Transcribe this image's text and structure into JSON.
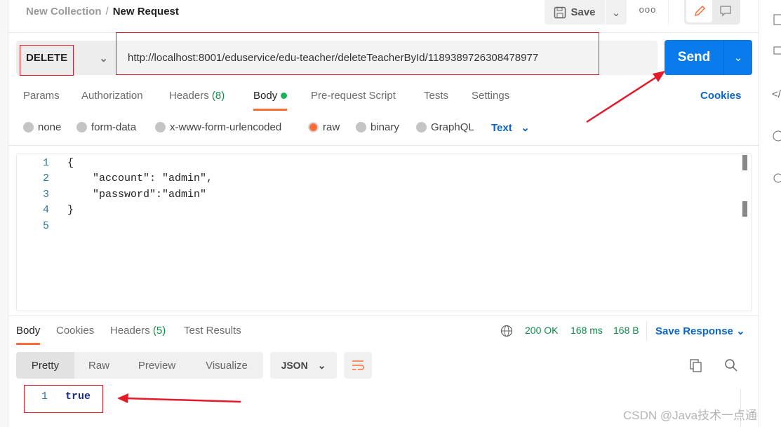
{
  "header": {
    "collection": "New Collection",
    "separator": "/",
    "request": "New Request",
    "save_label": "Save",
    "more_label": "ooo"
  },
  "request": {
    "method": "DELETE",
    "url": "http://localhost:8001/eduservice/edu-teacher/deleteTeacherById/1189389726308478977",
    "send_label": "Send"
  },
  "tabs": [
    {
      "label": "Params"
    },
    {
      "label": "Authorization"
    },
    {
      "label": "Headers",
      "count": "(8)"
    },
    {
      "label": "Body"
    },
    {
      "label": "Pre-request Script"
    },
    {
      "label": "Tests"
    },
    {
      "label": "Settings"
    }
  ],
  "cookies_label": "Cookies",
  "body_types": [
    "none",
    "form-data",
    "x-www-form-urlencoded",
    "raw",
    "binary",
    "GraphQL"
  ],
  "selected_body_type": "raw",
  "raw_format": "Text",
  "editor": {
    "line_numbers": [
      "1",
      "2",
      "3",
      "4",
      "5"
    ],
    "lines": [
      "{",
      "    \"account\": \"admin\",",
      "    \"password\":\"admin\"",
      "}",
      ""
    ]
  },
  "response": {
    "tabs": [
      {
        "label": "Body"
      },
      {
        "label": "Cookies"
      },
      {
        "label": "Headers",
        "count": "(5)"
      },
      {
        "label": "Test Results"
      }
    ],
    "status": "200 OK",
    "time": "168 ms",
    "size": "168 B",
    "save_label": "Save Response",
    "views": [
      "Pretty",
      "Raw",
      "Preview",
      "Visualize"
    ],
    "format": "JSON",
    "line_number": "1",
    "value": "true"
  },
  "watermark": "CSDN @Java技术一点通",
  "colors": {
    "accent": "#ff6c37",
    "send": "#097bed",
    "link": "#0b66c8",
    "status": "#0f8a4a",
    "annotation": "#e6192b"
  }
}
